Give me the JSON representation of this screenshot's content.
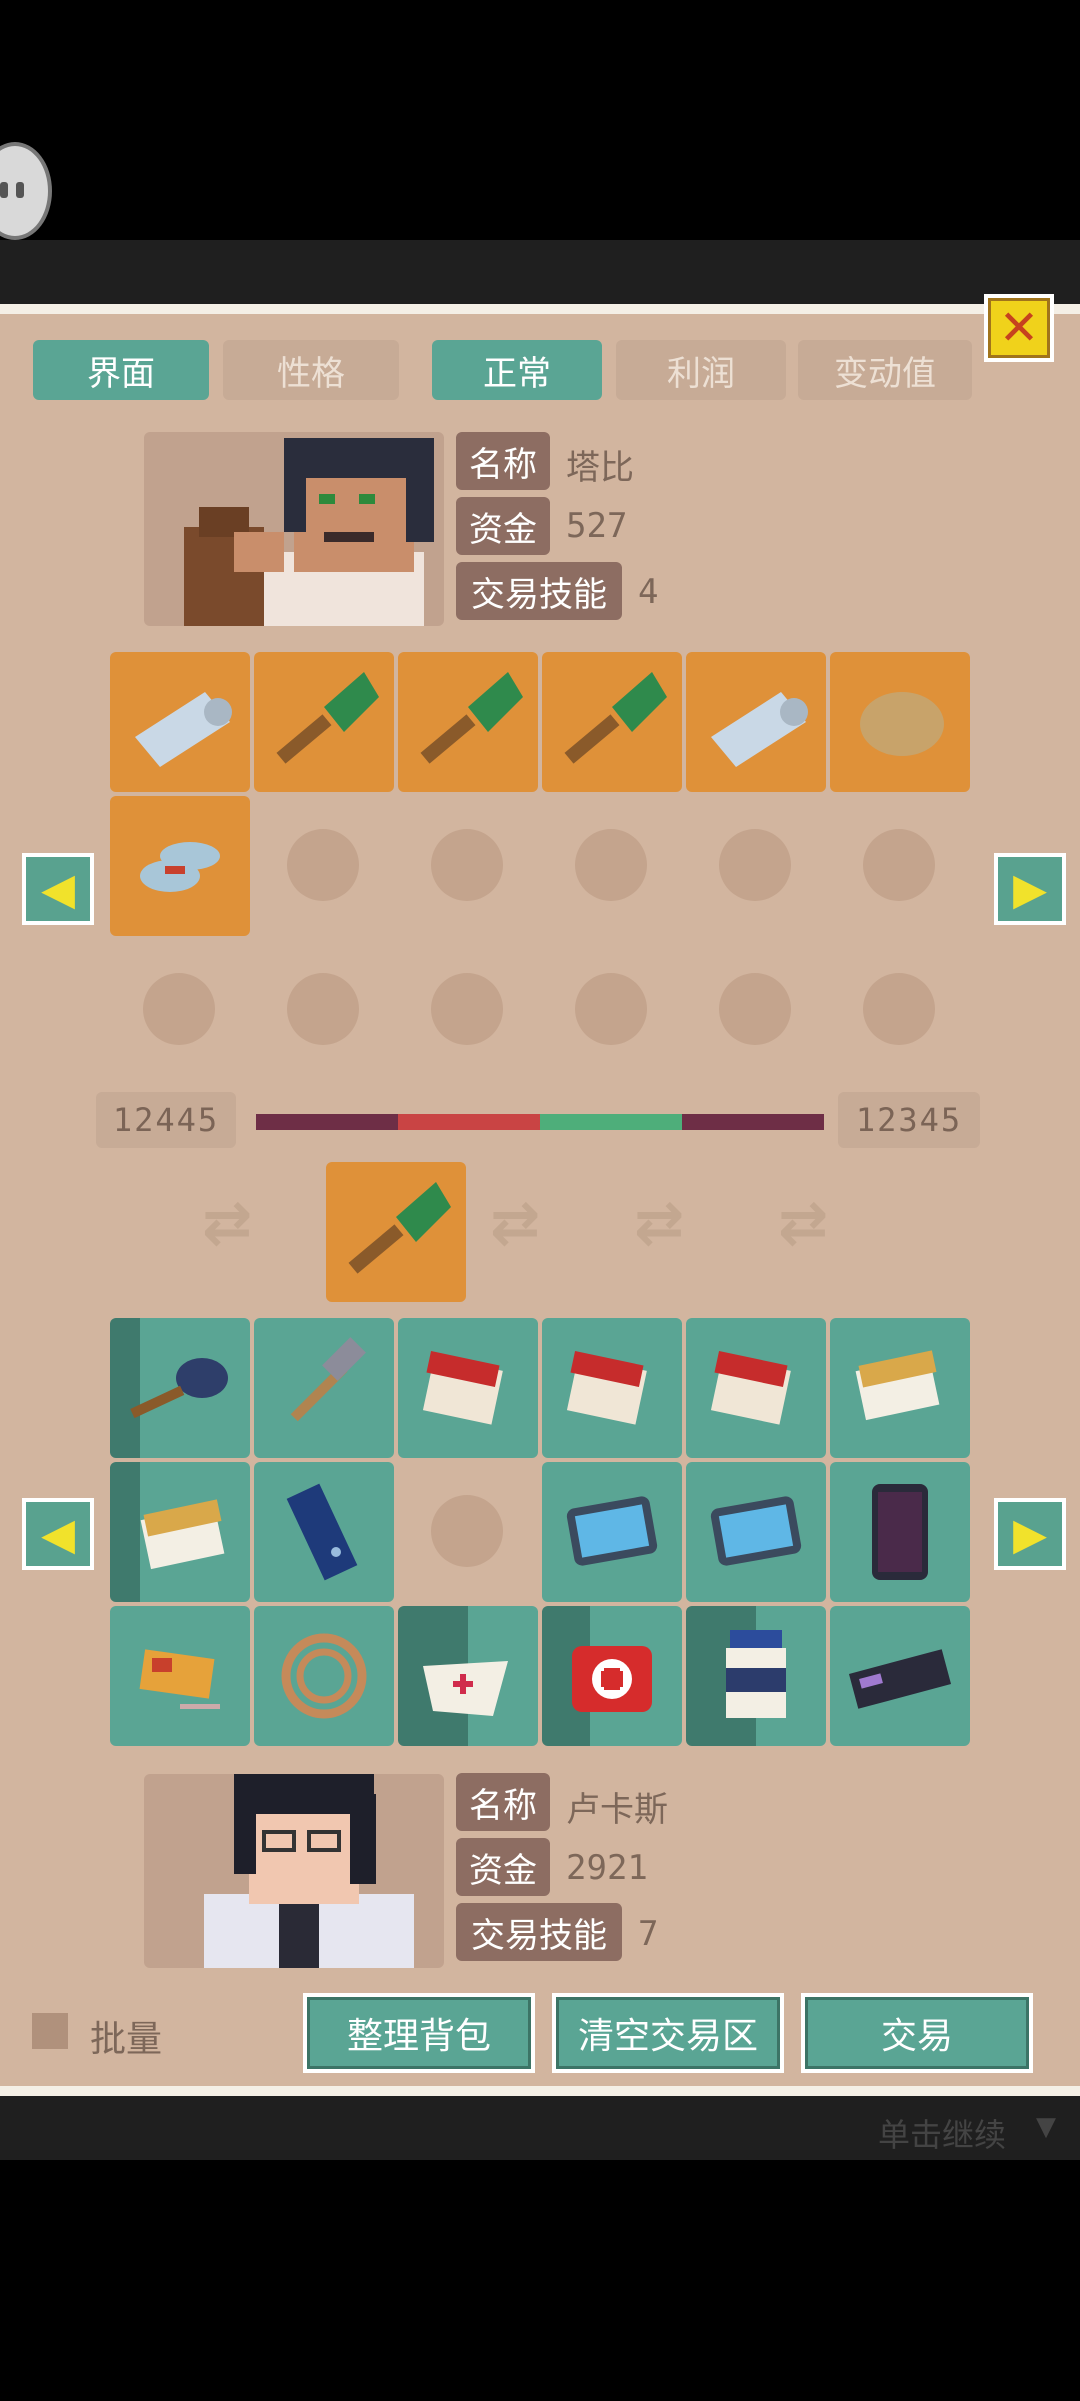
{
  "tabs": [
    "界面",
    "性格",
    "正常",
    "利润",
    "变动值"
  ],
  "trader": {
    "labels": {
      "name": "名称",
      "funds": "资金",
      "skill": "交易技能"
    },
    "name": "塔比",
    "funds": "527",
    "skill": "4"
  },
  "player": {
    "labels": {
      "name": "名称",
      "funds": "资金",
      "skill": "交易技能"
    },
    "name": "卢卡斯",
    "funds": "2921",
    "skill": "7"
  },
  "trader_items": [
    "net-icon",
    "trowel-icon",
    "trowel-icon",
    "trowel-icon",
    "net-icon",
    "stone-icon",
    "slippers-icon"
  ],
  "trade_bar": {
    "left_value": "12445",
    "right_value": "12345"
  },
  "trade_slot_item": "trowel-icon",
  "player_items": [
    "frying-pan-icon",
    "hammer-icon",
    "cigarettes-icon",
    "cigarettes-icon",
    "cigarettes-icon",
    "cigarette-pack-icon",
    "cigarette-pack-icon",
    "flashlight-icon",
    "",
    "tablet-icon",
    "tablet-icon",
    "phone-icon",
    "matchbox-icon",
    "rope-icon",
    "bandage-icon",
    "first-aid-kit-icon",
    "pill-bottle-icon",
    "harmonica-icon"
  ],
  "batch_label": "批量",
  "buttons": {
    "sort": "整理背包",
    "clear": "清空交易区",
    "trade": "交易"
  },
  "continue_hint": "单击继续",
  "colors": {
    "panel": "#d2b59f",
    "accent_green": "#5aa594",
    "slot_orange": "#df9139"
  }
}
